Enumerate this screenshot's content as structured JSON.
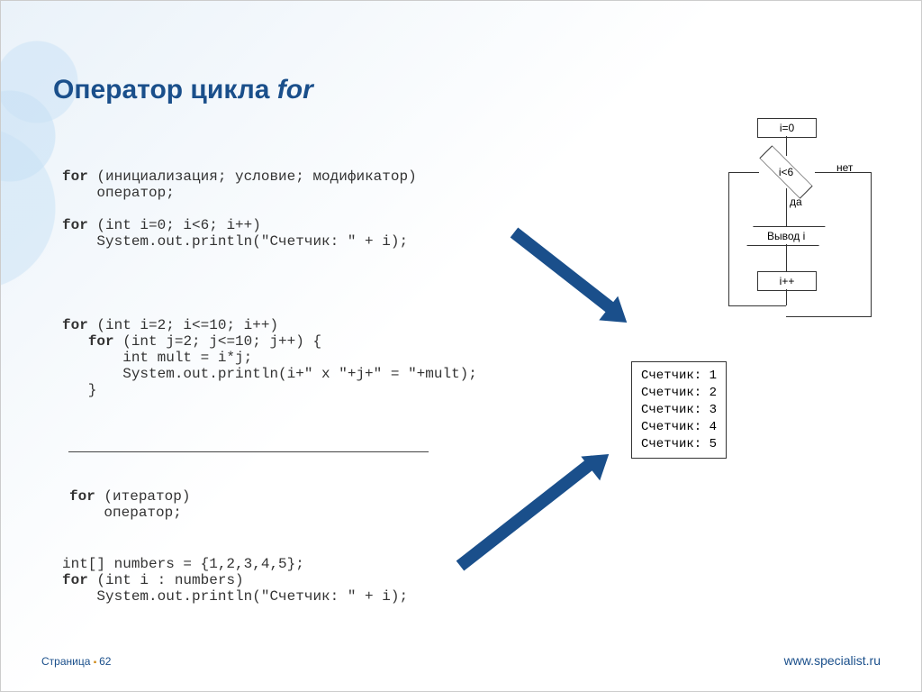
{
  "title_main": "Оператор цикла ",
  "title_ital": "for",
  "code1": "for (инициализация; условие; модификатор)\n    оператор;\n\nfor (int i=0; i<6; i++)\n    System.out.println(\"Счетчик: \" + i);",
  "code2": "for (int i=2; i<=10; i++)\n   for (int j=2; j<=10; j++) {\n       int mult = i*j;\n       System.out.println(i+\" x \"+j+\" = \"+mult);\n   }",
  "code3": "for (итератор)\n    оператор;",
  "code4": "int[] numbers = {1,2,3,4,5};\nfor (int i : numbers)\n    System.out.println(\"Счетчик: \" + i);",
  "output_lines": [
    "Счетчик: 1",
    "Счетчик: 2",
    "Счетчик: 3",
    "Счетчик: 4",
    "Счетчик: 5"
  ],
  "flow": {
    "init": "i=0",
    "cond": "i<6",
    "yes": "да",
    "no": "нет",
    "print": "Вывод i",
    "inc": "i++"
  },
  "footer": {
    "page_label": "Страница",
    "page_num": "62",
    "site": "www.specialist.ru"
  }
}
